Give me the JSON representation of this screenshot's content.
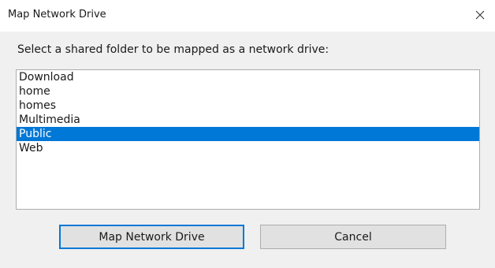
{
  "window": {
    "title": "Map Network Drive",
    "close_icon": "close-icon"
  },
  "prompt": "Select a shared folder to be mapped as a network drive:",
  "folders": [
    {
      "label": "Download",
      "selected": false
    },
    {
      "label": "home",
      "selected": false
    },
    {
      "label": "homes",
      "selected": false
    },
    {
      "label": "Multimedia",
      "selected": false
    },
    {
      "label": "Public",
      "selected": true
    },
    {
      "label": "Web",
      "selected": false
    }
  ],
  "buttons": {
    "map_label": "Map Network Drive",
    "cancel_label": "Cancel"
  },
  "colors": {
    "selection": "#0078d7",
    "dialog_body": "#f0f0f0",
    "button_face": "#e1e1e1"
  }
}
